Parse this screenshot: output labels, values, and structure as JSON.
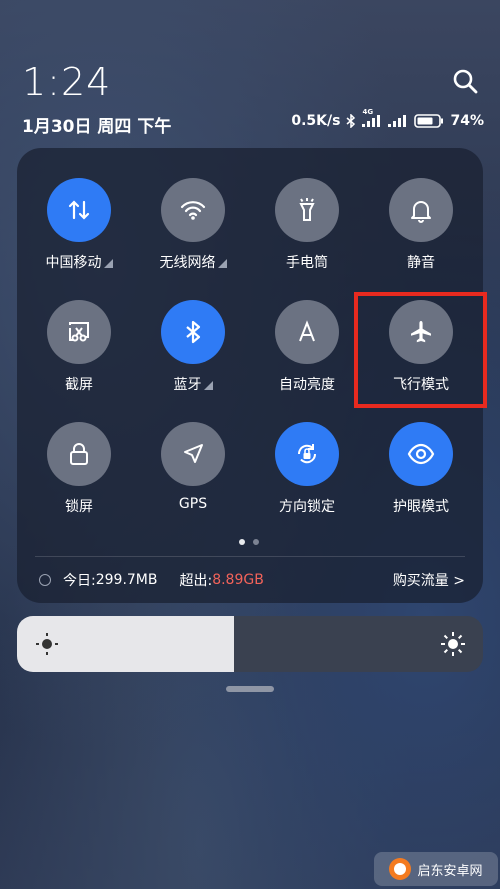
{
  "clock": {
    "time": "1:24",
    "date": "1月30日 周四 下午"
  },
  "status": {
    "speed": "0.5K/s",
    "network": "4G",
    "battery": "74%"
  },
  "tiles": [
    {
      "label": "中国移动",
      "icon": "data-arrows-icon",
      "on": true,
      "arrow": true
    },
    {
      "label": "无线网络",
      "icon": "wifi-icon",
      "on": false,
      "arrow": true
    },
    {
      "label": "手电筒",
      "icon": "flashlight-icon",
      "on": false,
      "arrow": false
    },
    {
      "label": "静音",
      "icon": "bell-icon",
      "on": false,
      "arrow": false
    },
    {
      "label": "截屏",
      "icon": "screenshot-icon",
      "on": false,
      "arrow": false
    },
    {
      "label": "蓝牙",
      "icon": "bluetooth-icon",
      "on": true,
      "arrow": true
    },
    {
      "label": "自动亮度",
      "icon": "auto-brightness-icon",
      "on": false,
      "arrow": false
    },
    {
      "label": "飞行模式",
      "icon": "airplane-icon",
      "on": false,
      "arrow": false
    },
    {
      "label": "锁屏",
      "icon": "lock-icon",
      "on": false,
      "arrow": false
    },
    {
      "label": "GPS",
      "icon": "location-icon",
      "on": false,
      "arrow": false
    },
    {
      "label": "方向锁定",
      "icon": "rotation-lock-icon",
      "on": true,
      "arrow": false
    },
    {
      "label": "护眼模式",
      "icon": "eye-icon",
      "on": true,
      "arrow": false
    }
  ],
  "data_usage": {
    "today_label": "今日:",
    "today_value": "299.7MB",
    "over_label": "超出:",
    "over_value": "8.89GB",
    "buy": "购买流量 >"
  },
  "brightness": {
    "level": 0.465
  },
  "watermark": {
    "text": "启东安卓网"
  },
  "colors": {
    "accent": "#2f7bf5",
    "tile_off": "#6b7282",
    "highlight": "#e82a1f",
    "over": "#f2635a"
  }
}
